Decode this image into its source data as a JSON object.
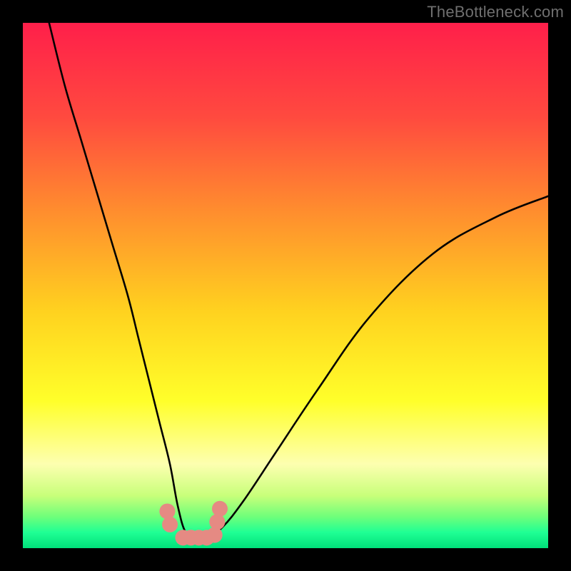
{
  "watermark": "TheBottleneck.com",
  "chart_data": {
    "type": "line",
    "title": "",
    "xlabel": "",
    "ylabel": "",
    "xlim": [
      0,
      100
    ],
    "ylim": [
      0,
      100
    ],
    "gradient_stops": [
      {
        "pct": 0,
        "color": "#ff1f4a"
      },
      {
        "pct": 18,
        "color": "#ff4a3f"
      },
      {
        "pct": 35,
        "color": "#ff8a2f"
      },
      {
        "pct": 55,
        "color": "#ffd21f"
      },
      {
        "pct": 72,
        "color": "#ffff2a"
      },
      {
        "pct": 84,
        "color": "#fdffb0"
      },
      {
        "pct": 90,
        "color": "#c8ff7a"
      },
      {
        "pct": 94,
        "color": "#6fff7a"
      },
      {
        "pct": 97,
        "color": "#1fff94"
      },
      {
        "pct": 100,
        "color": "#00e07a"
      }
    ],
    "series": [
      {
        "name": "curve",
        "color": "#000000",
        "x": [
          5,
          8,
          11,
          14,
          17,
          20,
          22,
          24,
          26,
          28,
          29.5,
          31,
          33,
          35,
          38,
          42,
          48,
          56,
          66,
          78,
          90,
          100
        ],
        "y": [
          100,
          88,
          78,
          68,
          58,
          48,
          40,
          32,
          24,
          16,
          8,
          3,
          2,
          2,
          4,
          9,
          18,
          30,
          44,
          56,
          63,
          67
        ]
      }
    ],
    "markers": {
      "name": "points",
      "color": "#e58a83",
      "x": [
        27.5,
        28.0,
        30.5,
        32.0,
        33.5,
        35.0,
        36.5,
        37.0,
        37.5
      ],
      "y": [
        7.0,
        4.5,
        2.0,
        2.0,
        2.0,
        2.0,
        2.5,
        5.0,
        7.5
      ]
    }
  }
}
